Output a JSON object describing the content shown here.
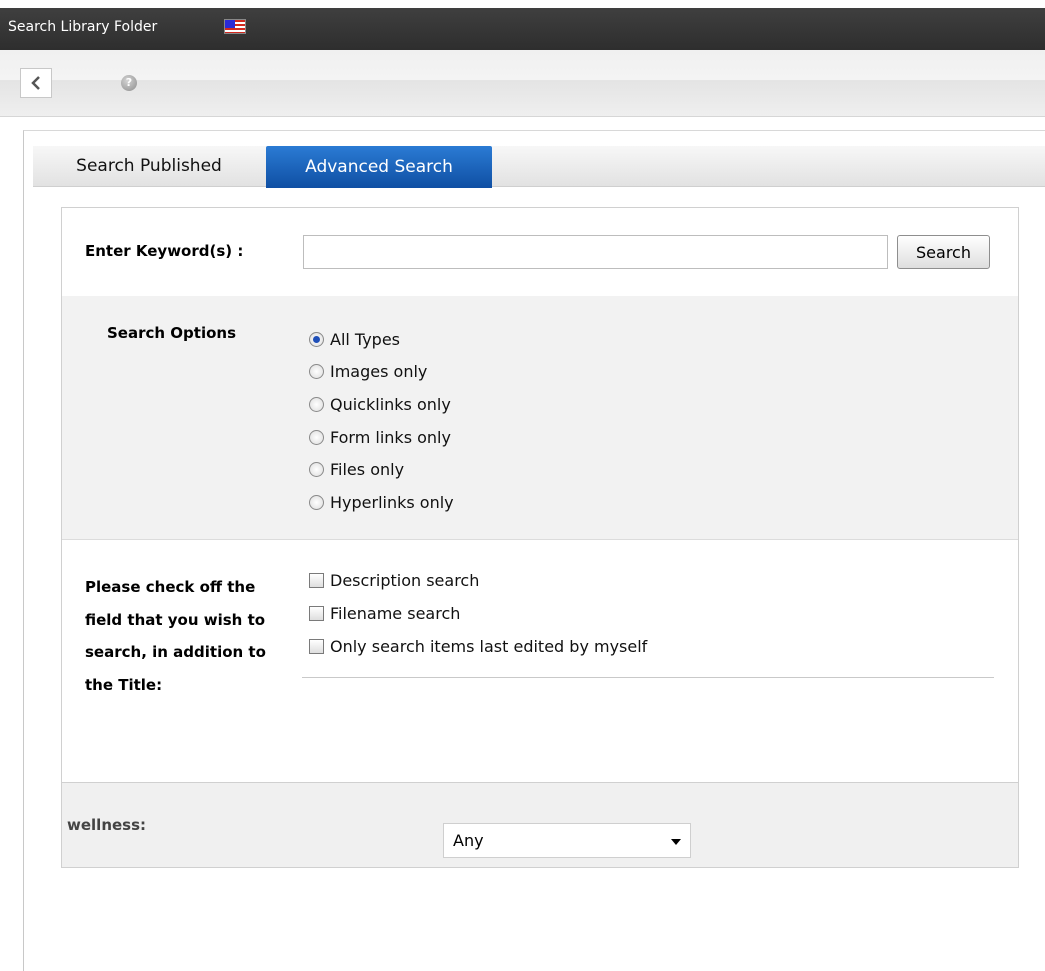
{
  "window": {
    "title": "Search Library Folder"
  },
  "toolbar": {
    "back_icon": "chevron-left-icon",
    "help_icon": "question-mark-icon",
    "help_glyph": "?"
  },
  "tabs": [
    {
      "label": "Search Published",
      "active": false
    },
    {
      "label": "Advanced Search",
      "active": true
    }
  ],
  "keyword": {
    "label": "Enter Keyword(s) :",
    "value": "",
    "search_button": "Search"
  },
  "search_options": {
    "label": "Search Options",
    "selected": "All Types",
    "options": [
      "All Types",
      "Images only",
      "Quicklinks only",
      "Form links only",
      "Files only",
      "Hyperlinks only"
    ]
  },
  "fields": {
    "label": "Please check off the field that you wish to search, in addition to the Title:",
    "checkboxes": [
      {
        "label": "Description search",
        "checked": false
      },
      {
        "label": "Filename search",
        "checked": false
      },
      {
        "label": "Only search items last edited by myself",
        "checked": false
      }
    ]
  },
  "wellness": {
    "label": "wellness:",
    "selected": "Any"
  },
  "colors": {
    "active_tab": "#1a62bf",
    "titlebar": "#363636",
    "options_bg": "#f2f2f2"
  }
}
